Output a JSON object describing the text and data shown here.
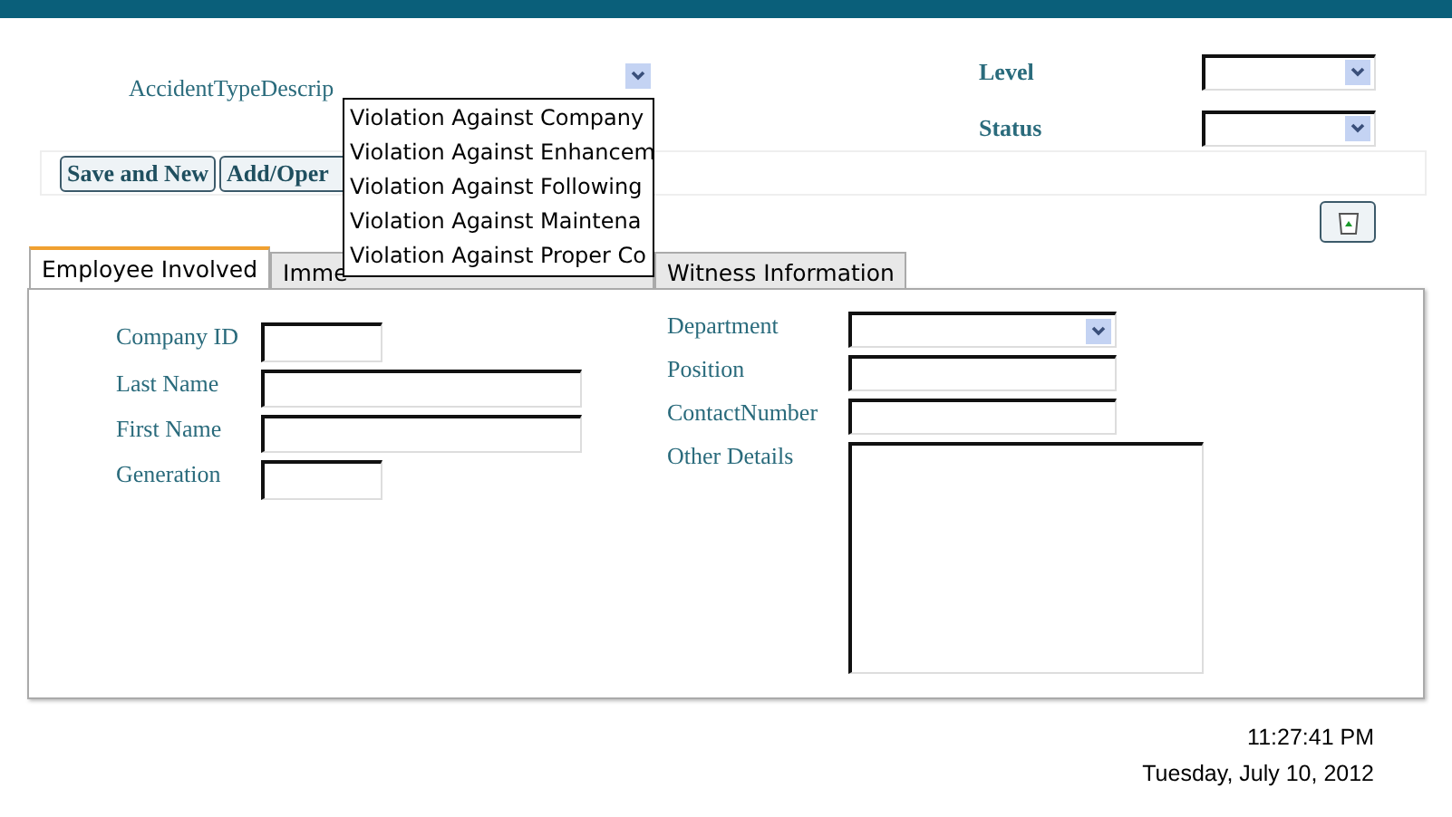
{
  "accident_type": {
    "label": "AccidentTypeDescrip",
    "expanded": true,
    "options": [
      "Violation Against Company",
      "Violation Against Enhancem",
      "Violation Against Following",
      "Violation Against Maintena",
      "Violation Against Proper Co"
    ]
  },
  "side_fields": [
    {
      "label": "Level"
    },
    {
      "label": "Status"
    }
  ],
  "buttons": [
    "Save and New",
    "Add/Oper"
  ],
  "tabs": [
    {
      "label": "Employee Involved",
      "selected": true
    },
    {
      "label": "Imme",
      "selected": false
    },
    {
      "label": "Witness Information",
      "selected": false
    }
  ],
  "left_fields": [
    {
      "label": "Company ID",
      "kind": "short"
    },
    {
      "label": "Last Name",
      "kind": "text"
    },
    {
      "label": "First Name",
      "kind": "text"
    },
    {
      "label": "Generation",
      "kind": "short"
    }
  ],
  "right_fields": [
    {
      "label": "Department",
      "kind": "combo"
    },
    {
      "label": "Position",
      "kind": "text"
    },
    {
      "label": "ContactNumber",
      "kind": "text"
    },
    {
      "label": "Other Details",
      "kind": "memo"
    }
  ],
  "time": "11:27:41 PM",
  "date": "Tuesday, July 10, 2012"
}
